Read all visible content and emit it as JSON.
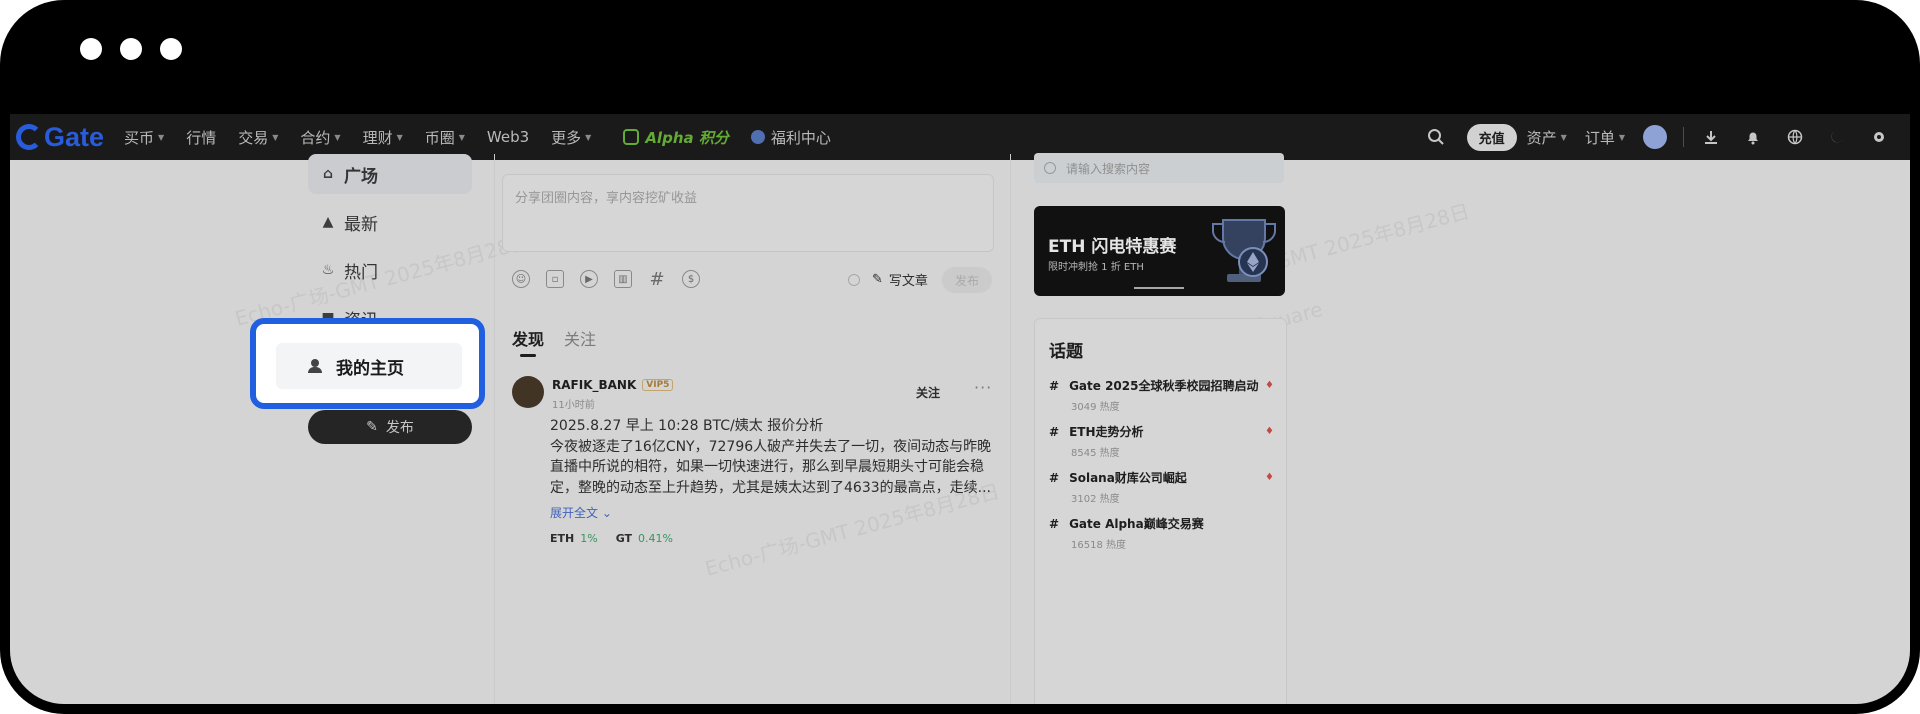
{
  "nav": {
    "logo_text": "Gate",
    "items": [
      {
        "label": "买币",
        "caret": true
      },
      {
        "label": "行情",
        "caret": false
      },
      {
        "label": "交易",
        "caret": true
      },
      {
        "label": "合约",
        "caret": true
      },
      {
        "label": "理财",
        "caret": true
      },
      {
        "label": "币圈",
        "caret": true
      },
      {
        "label": "Web3",
        "caret": false
      },
      {
        "label": "更多",
        "caret": true
      }
    ],
    "alpha_label": "Alpha 积分",
    "welfare_label": "福利中心",
    "recharge_label": "充值",
    "assets_label": "资产",
    "orders_label": "订单"
  },
  "sidebar": {
    "items": [
      {
        "label": "广场",
        "icon": "home-icon"
      },
      {
        "label": "最新",
        "icon": "thumbs-up-icon"
      },
      {
        "label": "热门",
        "icon": "flame-icon"
      },
      {
        "label": "资讯",
        "icon": "news-icon"
      }
    ],
    "highlight_label": "我的主页",
    "publish_label": "发布"
  },
  "composer": {
    "placeholder": "分享团圈内容，享内容挖矿收益",
    "write_article": "写文章",
    "post_button": "发布"
  },
  "tabs": {
    "discover": "发现",
    "follow": "关注"
  },
  "post": {
    "username": "RAFIK_BANK",
    "badge": "VIP5",
    "time": "11小时前",
    "follow": "关注",
    "more": "···",
    "headline": "2025.8.27 早上 10:28 BTC/姨太 报价分析",
    "body": "今夜被逐走了16亿CNY，72796人破产并失去了一切，夜间动态与昨晚直播中所说的相符，如果一切快速进行，那么到早晨短期头寸可能会稳定，整晚的动态至上升趋势，尤其是姨太达到了4633的最高点，走续...",
    "expand": "展开全文",
    "tags": [
      {
        "symbol": "ETH",
        "change": "1%"
      },
      {
        "symbol": "GT",
        "change": "0.41%"
      }
    ]
  },
  "right": {
    "search_placeholder": "请输入搜索内容",
    "banner_title": "ETH 闪电特惠赛",
    "banner_sub": "限时冲刺抢 1 折 ETH",
    "topics_title": "话题",
    "topics": [
      {
        "name": "Gate 2025全球秋季校园招聘启动",
        "heat": "3049 热度",
        "hot": true
      },
      {
        "name": "ETH走势分析",
        "heat": "8545 热度",
        "hot": true
      },
      {
        "name": "Solana财库公司崛起",
        "heat": "3102 热度",
        "hot": true
      },
      {
        "name": "Gate Alpha巅峰交易赛",
        "heat": "16518 热度",
        "hot": false
      }
    ]
  },
  "watermark": {
    "line1": "Echo-广场-GMT 2025年8月28日",
    "line2": "15:50 Square"
  }
}
